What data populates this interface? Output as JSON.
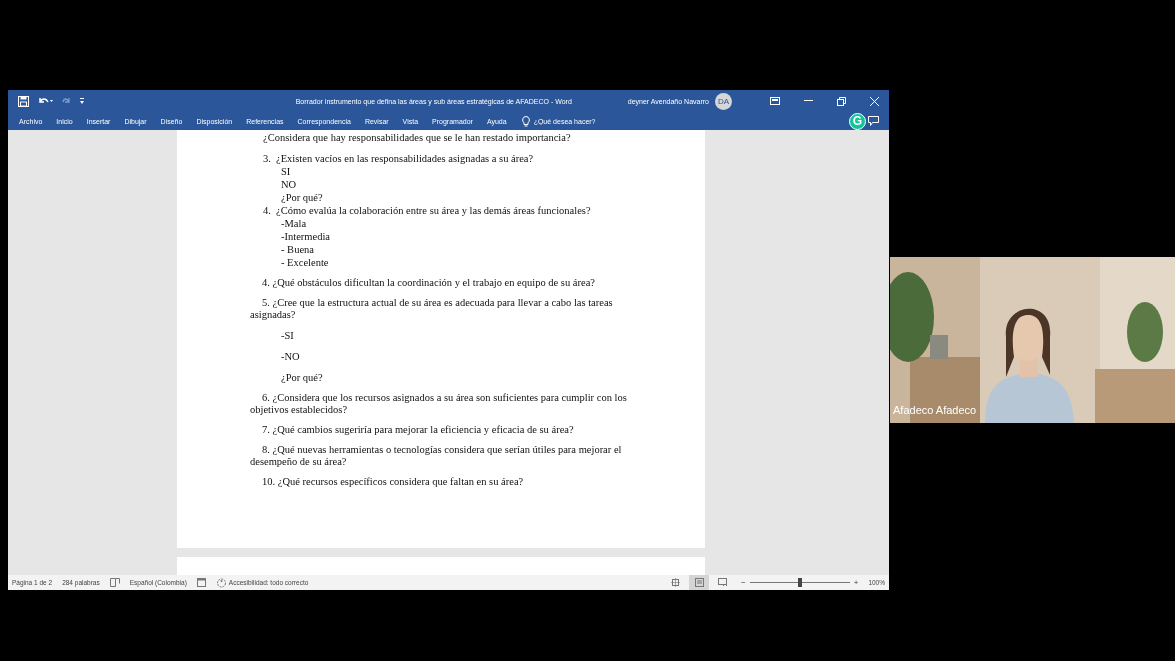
{
  "word": {
    "title": "Borrador instrumento que defina las áreas y sub áreas estratégicas de AFADECO  -  Word",
    "user": "deyner Avendaño Navarro",
    "avatar": "DA",
    "addin_badge": "G",
    "ribbon_tabs": [
      {
        "label": "Archivo"
      },
      {
        "label": "Inicio"
      },
      {
        "label": "Insertar"
      },
      {
        "label": "Dibujar"
      },
      {
        "label": "Diseño"
      },
      {
        "label": "Disposición"
      },
      {
        "label": "Referencias"
      },
      {
        "label": "Correspondencia"
      },
      {
        "label": "Revisar"
      },
      {
        "label": "Vista"
      },
      {
        "label": "Programador"
      },
      {
        "label": "Ayuda"
      }
    ],
    "tell_me": {
      "placeholder": "¿Qué desea hacer?"
    },
    "document": [
      {
        "kind": "lead",
        "text": "¿Considera que hay responsabilidades que se le han restado importancia?"
      },
      {
        "kind": "numbered",
        "number": "3.",
        "text": "¿Existen vacíos en las responsabilidades asignadas a su área?"
      },
      {
        "kind": "sub",
        "text": "SI"
      },
      {
        "kind": "sub",
        "text": "NO"
      },
      {
        "kind": "sub",
        "text": "¿Por qué?"
      },
      {
        "kind": "numbered",
        "number": "4.",
        "text": "¿Cómo evalúa la colaboración entre su área y las demás áreas funcionales?"
      },
      {
        "kind": "sub",
        "text": "-Mala"
      },
      {
        "kind": "sub",
        "text": "-Intermedia"
      },
      {
        "kind": "sub",
        "text": "- Buena"
      },
      {
        "kind": "sub",
        "text": "- Excelente"
      },
      {
        "kind": "inline",
        "text": "4. ¿Qué obstáculos dificultan la coordinación y el trabajo en equipo de su área?"
      },
      {
        "kind": "inline",
        "text": "5. ¿Cree que la estructura actual de su área es adecuada para llevar a cabo las tareas asignadas?"
      },
      {
        "kind": "option",
        "text": "-SI"
      },
      {
        "kind": "option",
        "text": "-NO"
      },
      {
        "kind": "option",
        "text": "¿Por qué?"
      },
      {
        "kind": "inline",
        "text": "6. ¿Considera que los recursos asignados a su área son suficientes para cumplir con los objetivos establecidos?"
      },
      {
        "kind": "inline",
        "text": "7. ¿Qué cambios sugeriría para mejorar la eficiencia y eficacia de su área?"
      },
      {
        "kind": "inline",
        "text": "8. ¿Qué nuevas herramientas o tecnologías considera que serían útiles para mejorar el desempeño de su área?"
      },
      {
        "kind": "inline",
        "text": "10. ¿Qué recursos específicos considera que faltan en su área?"
      }
    ],
    "status_bar": {
      "page": "Página 1 de 2",
      "words": "284 palabras",
      "language": "Español (Colombia)",
      "accessibility": "Accesibilidad: todo correcto",
      "views": [
        {
          "kind": "focus",
          "selected": false
        },
        {
          "kind": "print",
          "selected": true
        },
        {
          "kind": "web",
          "selected": false
        }
      ],
      "zoom_minus": "−",
      "zoom_plus": "+",
      "zoom": {
        "level": 0.5
      },
      "zoom_text": "100%"
    }
  },
  "video": {
    "participant": "Afadeco Afadeco"
  }
}
